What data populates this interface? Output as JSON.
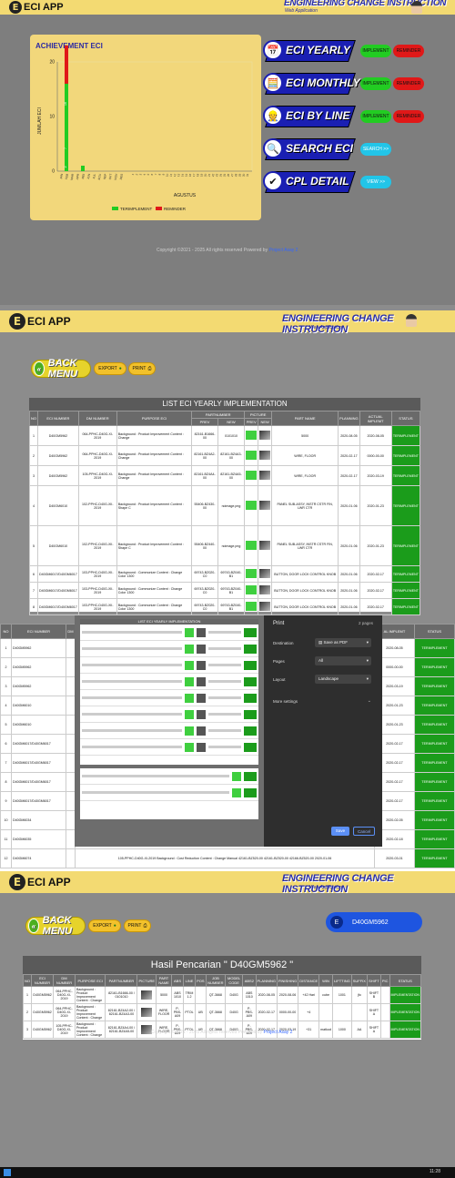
{
  "app": {
    "logo_letter": "E",
    "logo_text": "ECI APP",
    "title": "ENGINEERING CHANGE INSTRUCTION",
    "subtitle": "Web Application"
  },
  "achievement": {
    "title": "ACHIEVEMENT ECI",
    "xlabel": "AGUSTUS",
    "ylabel": "JUMLAH ECI"
  },
  "chart_data": {
    "type": "bar",
    "title": "ACHIEVEMENT ECI",
    "xlabel": "AGUSTUS",
    "ylabel": "JUMLAH ECI",
    "ylim": [
      0,
      20
    ],
    "yticks": [
      "0",
      "10",
      "20"
    ],
    "series": [
      {
        "name": "TERIMPLEMENT",
        "color": "#22cc22",
        "values": [
          16,
          0,
          1
        ]
      },
      {
        "name": "REMINDER",
        "color": "#e01818",
        "values": [
          7,
          0,
          0
        ]
      }
    ],
    "bar_labels": [
      "16",
      "7",
      "2"
    ],
    "legend_position": "bottom",
    "grid": false
  },
  "menu": {
    "yearly": "ECI YEARLY",
    "monthly": "ECI MONTHLY",
    "by_line": "ECI BY LINE",
    "search": "SEARCH ECI",
    "cpl": "CPL DETAIL",
    "implement": "IMPLEMENT",
    "reminder": "REMINDER",
    "search_btn": "SEARCH >>",
    "view_btn": "VIEW >>"
  },
  "footer": {
    "text": "Copyright ©2021 - 2025 All rights reserved Powered by ",
    "link": "Project Asay 2"
  },
  "toolbar": {
    "back": "BACK MENU",
    "export": "EXPORT",
    "print": "PRINT"
  },
  "yearly": {
    "title": "LIST ECI YEARLY IMPLEMENTATION",
    "headers": [
      "NO",
      "ECI NUMBER",
      "DM NUMBER",
      "PURPOSE ECI",
      "PARTNUMBER",
      "PICTURE",
      "PART NAME",
      "PLANNING",
      "ACTUAL IMPLEMT",
      "STATUS"
    ],
    "subheaders": [
      "PREV",
      "NEW",
      "PREV",
      "NEW"
    ],
    "rows": [
      {
        "no": "1",
        "eci": "D40GM5962",
        "dm": "064-PPHC-D40G-XI-2019",
        "purpose": "Background : Product Improvement Content : Change",
        "prev": "82161-B1666-00",
        "new": "0101010",
        "part": "5000",
        "plan": "2020-08-05",
        "actual": "2020-08-05",
        "status": "TERIMPLEMENT"
      },
      {
        "no": "2",
        "eci": "D40GM5962",
        "dm": "064-PPHC-D40G-XI-2019",
        "purpose": "Background : Product Improvement Content : Change",
        "prev": "82161-BZ4A2-00",
        "new": "82161-BZ4A3-00",
        "part": "WIRE, FLOOR",
        "plan": "2020-02-17",
        "actual": "0000-00-00",
        "status": "TERIMPLEMENT"
      },
      {
        "no": "3",
        "eci": "D40GM5962",
        "dm": "105-PPHC-D40G-XI-2019",
        "purpose": "Background : Product Improvement Content : Change",
        "prev": "82161-BZ4A4-00",
        "new": "82161-BZ4A5-00",
        "part": "WIRE, FLOOR",
        "plan": "2020-02-17",
        "actual": "2020-03-19",
        "status": "TERIMPLEMENT"
      },
      {
        "no": "4",
        "eci": "D40GM6010",
        "dm": "102-PPHC-D40G-XII-2019",
        "purpose": "Background : Product Improvement Content : Shape C",
        "prev": "55406-BZ430-00",
        "new": "noimage.png",
        "part": "PANEL SUB-ASSY, INSTR CSTR FIN, LWR CTR",
        "plan": "2020-01-06",
        "actual": "2020-01-23",
        "status": "TERIMPLEMENT"
      },
      {
        "no": "5",
        "eci": "D40GM6010",
        "dm": "102-PPHC-D40G-XII-2019",
        "purpose": "Background : Product Improvement Content : Shape C",
        "prev": "55406-BZ440-00",
        "new": "noimage.png",
        "part": "PANEL SUB-ASSY, INSTR CSTR FIN, LWR CTR",
        "plan": "2020-01-06",
        "actual": "2020-01-23",
        "status": "TERIMPLEMENT"
      },
      {
        "no": "6",
        "eci": "D40GM6017/D40GM6017",
        "dm": "103-PPHC-D40G-XII-2019",
        "purpose": "Background : Commonize Content : Change Color 1300",
        "prev": "69743-BZ020-C0",
        "new": "69743-BZ040-B1",
        "part": "BUTTON, DOOR LOCK CONTROL KNOB",
        "plan": "2020-01-06",
        "actual": "2020-02-17",
        "status": "TERIMPLEMENT"
      },
      {
        "no": "7",
        "eci": "D40GM6017/D40GM6017",
        "dm": "103-PPHC-D40G-XII-2019",
        "purpose": "Background : Commonize Content : Change Color 1300",
        "prev": "69743-BZ020-C0",
        "new": "69743-BZ040-B1",
        "part": "BUTTON, DOOR LOCK CONTROL KNOB",
        "plan": "2020-01-06",
        "actual": "2020-02-17",
        "status": "TERIMPLEMENT"
      },
      {
        "no": "8",
        "eci": "D40GM6017/D40GM6017",
        "dm": "103-PPHC-D40G-XII-2019",
        "purpose": "Background : Commonize Content : Change Color 1300",
        "prev": "69743-BZ020-C0",
        "new": "69743-BZ040-B1",
        "part": "BUTTON, DOOR LOCK CONTROL KNOB",
        "plan": "2020-01-06",
        "actual": "2020-02-17",
        "status": "TERIMPLEMENT"
      }
    ],
    "lower_rows": [
      {
        "no": "1",
        "eci": "D40GM5962",
        "plan": "2020-08-05",
        "status": "TERIMPLEMENT"
      },
      {
        "no": "2",
        "eci": "D40GM5962",
        "plan": "0000-00-00",
        "status": "TERIMPLEMENT"
      },
      {
        "no": "3",
        "eci": "D40GM5962",
        "plan": "2020-03-19",
        "status": "TERIMPLEMENT"
      },
      {
        "no": "4",
        "eci": "D40GM6010",
        "plan": "2020-01-23",
        "status": "TERIMPLEMENT"
      },
      {
        "no": "5",
        "eci": "D40GM6010",
        "plan": "2020-01-23",
        "status": "TERIMPLEMENT"
      },
      {
        "no": "6",
        "eci": "D40GM6017/D40GM6017",
        "plan": "2020-02-17",
        "status": "TERIMPLEMENT"
      },
      {
        "no": "7",
        "eci": "D40GM6017/D40GM6017",
        "plan": "2020-02-17",
        "status": "TERIMPLEMENT"
      },
      {
        "no": "8",
        "eci": "D40GM6017/D40GM6017",
        "plan": "2020-02-17",
        "status": "TERIMPLEMENT"
      },
      {
        "no": "9",
        "eci": "D40GM6017/D40GM6017",
        "plan": "2020-02-17",
        "status": "TERIMPLEMENT"
      },
      {
        "no": "10",
        "eci": "D40GM6034",
        "plan": "2020-02-05",
        "status": "TERIMPLEMENT"
      },
      {
        "no": "11",
        "eci": "D40GM6035",
        "plan": "2020-02-18",
        "status": "TERIMPLEMENT"
      },
      {
        "no": "12",
        "eci": "D40GM6074",
        "plan": "2020-03-01",
        "status": "TERIMPLEMENT"
      }
    ],
    "lower_headers": [
      "NO",
      "ECI NUMBER",
      "DM",
      "AL IMPLEMT",
      "STATUS"
    ],
    "row12": {
      "dm": "105-PPHC-D40G-XI-2019",
      "purpose": "Background : Cost Reduction Content : Change Manual",
      "prev": "42161-BZ520-00",
      "new": "42161-BZ520-00",
      "part": "42166-BZ520-00",
      "plan": "2020-01-06"
    }
  },
  "print_dialog": {
    "title": "Print",
    "pages_count": "2 pages",
    "destination_label": "Destination",
    "destination_value": "Save as PDF",
    "pages_label": "Pages",
    "pages_value": "All",
    "layout_label": "Layout",
    "layout_value": "Landscape",
    "more": "More settings",
    "save": "Save",
    "cancel": "Cancel",
    "preview_title": "LIST ECI YEARLY IMPLEMENTATION"
  },
  "search": {
    "value": "D40GM5962",
    "result_title": "Hasil Pencarian \" D40GM5962 \"",
    "headers": [
      "NO",
      "ECI NUMBER",
      "DM NUMBER",
      "PURPOSE ECI",
      "PARTNUMBER",
      "PICTURE",
      "PART NAME",
      "ABS",
      "LINE",
      "POS",
      "JOB NUMBER",
      "MODEL CODE",
      "ABS2",
      "PLANNING",
      "FINISHING",
      "DISTANCE",
      "WIN",
      "LIFTTING",
      "SUFFIX",
      "SHIFT",
      "PIC",
      "STATUS"
    ],
    "rows": [
      {
        "no": "1",
        "eci": "D40GM5962",
        "dm": "064-PPHC-D40G-XI-2019",
        "purpose": "Background : Product Improvement Content : Change",
        "prev": "82161-B1666-00",
        "new": "0101010",
        "part": "5000",
        "abs": "ABS 1010",
        "line": "TRIM 1.2",
        "pos": "",
        "job": "QT-3668",
        "model": "D40G",
        "abs2": "ABS 1010",
        "plan": "2020-08-05",
        "fin": "2020-08-06",
        "dist": "+42 Hari",
        "win": "cube",
        "lift": "1001",
        "suffix": "jfo",
        "shift": "SHIFT B",
        "status": "IMPLEMENTATION"
      },
      {
        "no": "2",
        "eci": "D40GM5962",
        "dm": "064-PPHC-D40G-XI-2019",
        "purpose": "Background : Product Improvement Content : Change",
        "prev": "82161-BZ4A2-00",
        "new": "82161-BZ4A3-00",
        "part": "WIRE, FLOOR",
        "abs": "P-PBS-A09",
        "line": "PTOL",
        "pos": "UB",
        "job": "QT-3668",
        "model": "D40G",
        "abs2": "P-PBS-A09",
        "plan": "2020-02-17",
        "fin": "0000-00-00",
        "dist": "+4",
        "win": "",
        "lift": "",
        "suffix": "",
        "shift": "SHIFT A",
        "status": "IMPLEMENTATION"
      },
      {
        "no": "3",
        "eci": "D40GM5962",
        "dm": "105-PPHC-D40G-XI-2019",
        "purpose": "Background : Product Improvement Content : Change",
        "prev": "82161-BZ4A4-00",
        "new": "82161-BZ4A5-00",
        "part": "WIRE, FLOOR",
        "abs": "P-PBS-A09",
        "line": "PTOL",
        "pos": "UB",
        "job": "QT-3668",
        "model": "D40G",
        "abs2": "P-PBS-A09",
        "plan": "2020-02-17",
        "fin": "2020-03-19",
        "dist": "+31",
        "win": "matkod",
        "lift": "1000",
        "suffix": "AA",
        "shift": "SHIFT A",
        "status": "IMPLEMENTATION"
      }
    ]
  },
  "clock": "11:28"
}
